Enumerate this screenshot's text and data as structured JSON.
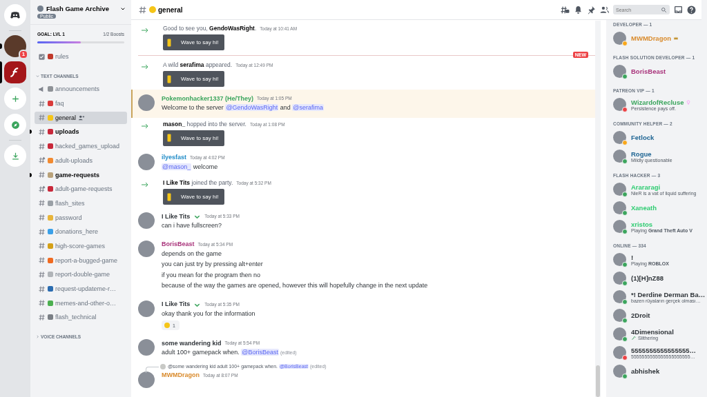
{
  "servers": [
    {
      "kind": "home",
      "selected": false
    },
    {
      "kind": "avatar",
      "selected": false,
      "badge": "1"
    },
    {
      "kind": "flash",
      "selected": true
    },
    {
      "kind": "add",
      "selected": false
    },
    {
      "kind": "explore",
      "selected": false
    },
    {
      "kind": "download",
      "selected": false
    }
  ],
  "server": {
    "name": "Flash Game Archive",
    "visibility": "Public",
    "goal": "GOAL: LVL 1",
    "boosts": "1/2 Boosts",
    "level": 0.5
  },
  "top_channels": [
    {
      "kind": "rules",
      "name": "rules",
      "color": "#c0392b",
      "selected": false,
      "unread": false
    }
  ],
  "categories": [
    {
      "name": "TEXT CHANNELS",
      "expanded": true,
      "channels": [
        {
          "kind": "announcement",
          "name": "announcements",
          "color": "#8e9297",
          "selected": false,
          "unread": false
        },
        {
          "kind": "text",
          "name": "faq",
          "color": "#d93a3a",
          "selected": false,
          "unread": false
        },
        {
          "kind": "text",
          "name": "general",
          "color": "#f5c518",
          "selected": true,
          "unread": false
        },
        {
          "kind": "text",
          "name": "uploads",
          "color": "#c8283a",
          "selected": false,
          "unread": true
        },
        {
          "kind": "text",
          "name": "hacked_games_upload",
          "color": "#c8283a",
          "selected": false,
          "unread": false
        },
        {
          "kind": "nsfw",
          "name": "adult-uploads",
          "color": "#f28a30",
          "selected": false,
          "unread": false
        },
        {
          "kind": "text",
          "name": "game-requests",
          "color": "#b9a27a",
          "selected": false,
          "unread": true
        },
        {
          "kind": "nsfw",
          "name": "adult-game-requests",
          "color": "#c8283a",
          "selected": false,
          "unread": false
        },
        {
          "kind": "text",
          "name": "flash_sites",
          "color": "#9aa0a6",
          "selected": false,
          "unread": false
        },
        {
          "kind": "text",
          "name": "password",
          "color": "#e8b53a",
          "selected": false,
          "unread": false
        },
        {
          "kind": "text",
          "name": "donations_here",
          "color": "#3aa0e8",
          "selected": false,
          "unread": false
        },
        {
          "kind": "text",
          "name": "high-score-games",
          "color": "#d4a017",
          "selected": false,
          "unread": false
        },
        {
          "kind": "text",
          "name": "report-a-bugged-game",
          "color": "#f06a20",
          "selected": false,
          "unread": false
        },
        {
          "kind": "text",
          "name": "report-double-game",
          "color": "#b0b4b8",
          "selected": false,
          "unread": false
        },
        {
          "kind": "text",
          "name": "request-updateme-r…",
          "color": "#2b6cb0",
          "selected": false,
          "unread": false
        },
        {
          "kind": "text",
          "name": "memes-and-other-o…",
          "color": "#4caf50",
          "selected": false,
          "unread": false
        },
        {
          "kind": "text",
          "name": "flash_technical",
          "color": "#7a7f85",
          "selected": false,
          "unread": false
        }
      ]
    },
    {
      "name": "VOICE CHANNELS",
      "expanded": false
    }
  ],
  "channel_header": {
    "name": "general",
    "color": "#f5c518",
    "search": {
      "placeholder": "Search"
    }
  },
  "messages": [
    {
      "kind": "join",
      "text": "Good to see you, **GendoWasRight**.",
      "time": "Today at 10:41 AM",
      "button": "Wave to say hi!"
    },
    {
      "kind": "divider",
      "label": "NEW"
    },
    {
      "kind": "join",
      "text": "A wild **serafima** appeared.",
      "time": "Today at 12:49 PM",
      "button": "Wave to say hi!"
    },
    {
      "kind": "message",
      "author": "Pokemonhacker1337 (He/They)",
      "color": "#3ba55d",
      "badge": false,
      "time": "Today at 1:05 PM",
      "highlighted": true,
      "lines": [
        [
          {
            "kind": "text",
            "text": "Welcome to the server "
          },
          {
            "kind": "mention",
            "text": "@GendoWasRight"
          },
          {
            "kind": "text",
            "text": " and "
          },
          {
            "kind": "mention",
            "text": "@serafima"
          }
        ]
      ]
    },
    {
      "kind": "join",
      "text": "**mason_** hopped into the server.",
      "time": "Today at 1:08 PM",
      "button": "Wave to say hi!"
    },
    {
      "kind": "message",
      "author": "ilyesfast",
      "color": "#1f8bc7",
      "badge": false,
      "time": "Today at 4:02 PM",
      "highlighted": false,
      "lines": [
        [
          {
            "kind": "mention",
            "text": "@mason_"
          },
          {
            "kind": "text",
            "text": " welcome"
          }
        ]
      ]
    },
    {
      "kind": "join",
      "text": "**I Like Tits** joined the party.",
      "time": "Today at 5:32 PM",
      "button": "Wave to say hi!"
    },
    {
      "kind": "message",
      "author": "I Like Tits",
      "color": "#2e3338",
      "badge": true,
      "time": "Today at 5:33 PM",
      "highlighted": false,
      "lines": [
        [
          {
            "kind": "text",
            "text": "can i have fullscreen?"
          }
        ]
      ]
    },
    {
      "kind": "message",
      "author": "BorisBeast",
      "color": "#a8327a",
      "badge": false,
      "time": "Today at 5:34 PM",
      "highlighted": false,
      "lines": [
        [
          {
            "kind": "text",
            "text": "depends on the game"
          }
        ],
        [
          {
            "kind": "text",
            "text": "you can just try by pressing alt+enter"
          }
        ],
        [
          {
            "kind": "text",
            "text": "if you mean for the program then no"
          }
        ],
        [
          {
            "kind": "text",
            "text": "because of the way the games are opened, however this will hopefully change in the next update"
          }
        ]
      ]
    },
    {
      "kind": "message",
      "author": "I Like Tits",
      "color": "#2e3338",
      "badge": true,
      "time": "Today at 5:35 PM",
      "highlighted": false,
      "lines": [
        [
          {
            "kind": "text",
            "text": "okay thank you for the information"
          }
        ]
      ],
      "reaction": {
        "count": "1"
      }
    },
    {
      "kind": "message",
      "author": "some wandering kid",
      "color": "#2e3338",
      "badge": false,
      "time": "Today at 5:54 PM",
      "highlighted": false,
      "lines": [
        [
          {
            "kind": "text",
            "text": "adult 100+ gamepack when. "
          },
          {
            "kind": "mention",
            "text": "@BorisBeast"
          },
          {
            "kind": "edited",
            "text": " (edited)"
          }
        ]
      ]
    },
    {
      "kind": "message",
      "author": "MWMDragon",
      "color": "#d98a2b",
      "badge": false,
      "time": "Today at 8:07 PM",
      "highlighted": false,
      "reply": [
        {
          "kind": "text",
          "text": "@some wandering kid adult 100+ gamepack when. "
        },
        {
          "kind": "mention",
          "text": "@BorisBeast"
        },
        {
          "kind": "edited",
          "text": " (edited)"
        }
      ]
    }
  ],
  "member_groups": [
    {
      "title": "DEVELOPER — 1",
      "members": [
        {
          "name": "MWMDragon",
          "color": "#d98a2b",
          "kind": "idle",
          "owner": true
        }
      ]
    },
    {
      "title": "FLASH SOLUTION DEVELOPER — 1",
      "members": [
        {
          "name": "BorisBeast",
          "color": "#a8327a",
          "kind": "online"
        }
      ]
    },
    {
      "title": "PATREON VIP — 1",
      "members": [
        {
          "name": "WizardofRecluse",
          "color": "#3ba55d",
          "kind": "dnd",
          "booster": true,
          "activity": "Persistence pays off."
        }
      ]
    },
    {
      "title": "COMMUNITY HELPER — 2",
      "members": [
        {
          "name": "Fetlock",
          "color": "#206694",
          "kind": "idle"
        },
        {
          "name": "Rogue",
          "color": "#206694",
          "kind": "online",
          "activity": "Mildly questionable"
        }
      ]
    },
    {
      "title": "FLASH HACKER — 3",
      "members": [
        {
          "name": "Arararagi",
          "color": "#2ecc71",
          "kind": "online",
          "activity": "NieR is a vat of liquid suffering"
        },
        {
          "name": "Xaneath",
          "color": "#2ecc71",
          "kind": "online"
        },
        {
          "name": "xristos",
          "color": "#2ecc71",
          "kind": "online",
          "activity": "Playing **Grand Theft Auto V**"
        }
      ]
    },
    {
      "title": "ONLINE — 334",
      "members": [
        {
          "name": "!",
          "color": "#2e3338",
          "kind": "online",
          "activity": "Playing **ROBLOX**"
        },
        {
          "name": "(1)[H]nZ88",
          "color": "#2e3338",
          "kind": "online"
        },
        {
          "name": "*! Derdine Derman Ba…",
          "color": "#2e3338",
          "kind": "online",
          "activity": "bazen rüyaların gerçek olması…"
        },
        {
          "name": "2Droit",
          "color": "#2e3338",
          "kind": "online"
        },
        {
          "name": "4Dimensional",
          "color": "#2e3338",
          "kind": "online",
          "activity_icon": true,
          "activity": "Slithering"
        },
        {
          "name": "5555555555555555…",
          "color": "#2e3338",
          "kind": "dnd",
          "activity": "5555555555555555555555…"
        },
        {
          "name": "abhishek",
          "color": "#2e3338",
          "kind": "online"
        }
      ]
    }
  ]
}
